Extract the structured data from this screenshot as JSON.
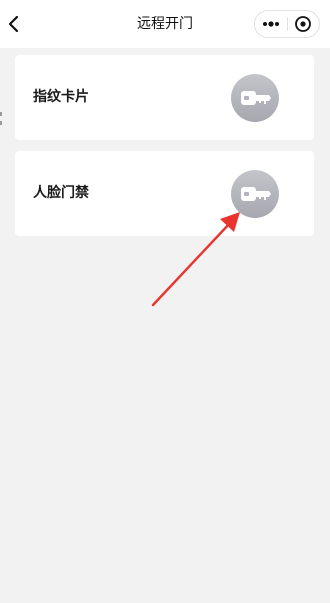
{
  "navbar": {
    "title": "远程开门",
    "back_icon": "chevron-left-icon",
    "more_icon": "more-dots-icon",
    "close_icon": "target-circle-icon"
  },
  "cards": [
    {
      "label": "指纹卡片",
      "icon": "key-icon"
    },
    {
      "label": "人脸门禁",
      "icon": "key-icon"
    }
  ],
  "colors": {
    "page_background": "#f2f2f2",
    "card_background": "#ffffff",
    "unlock_button": "#b3b3bb",
    "annotation_arrow": "#e8352f"
  }
}
